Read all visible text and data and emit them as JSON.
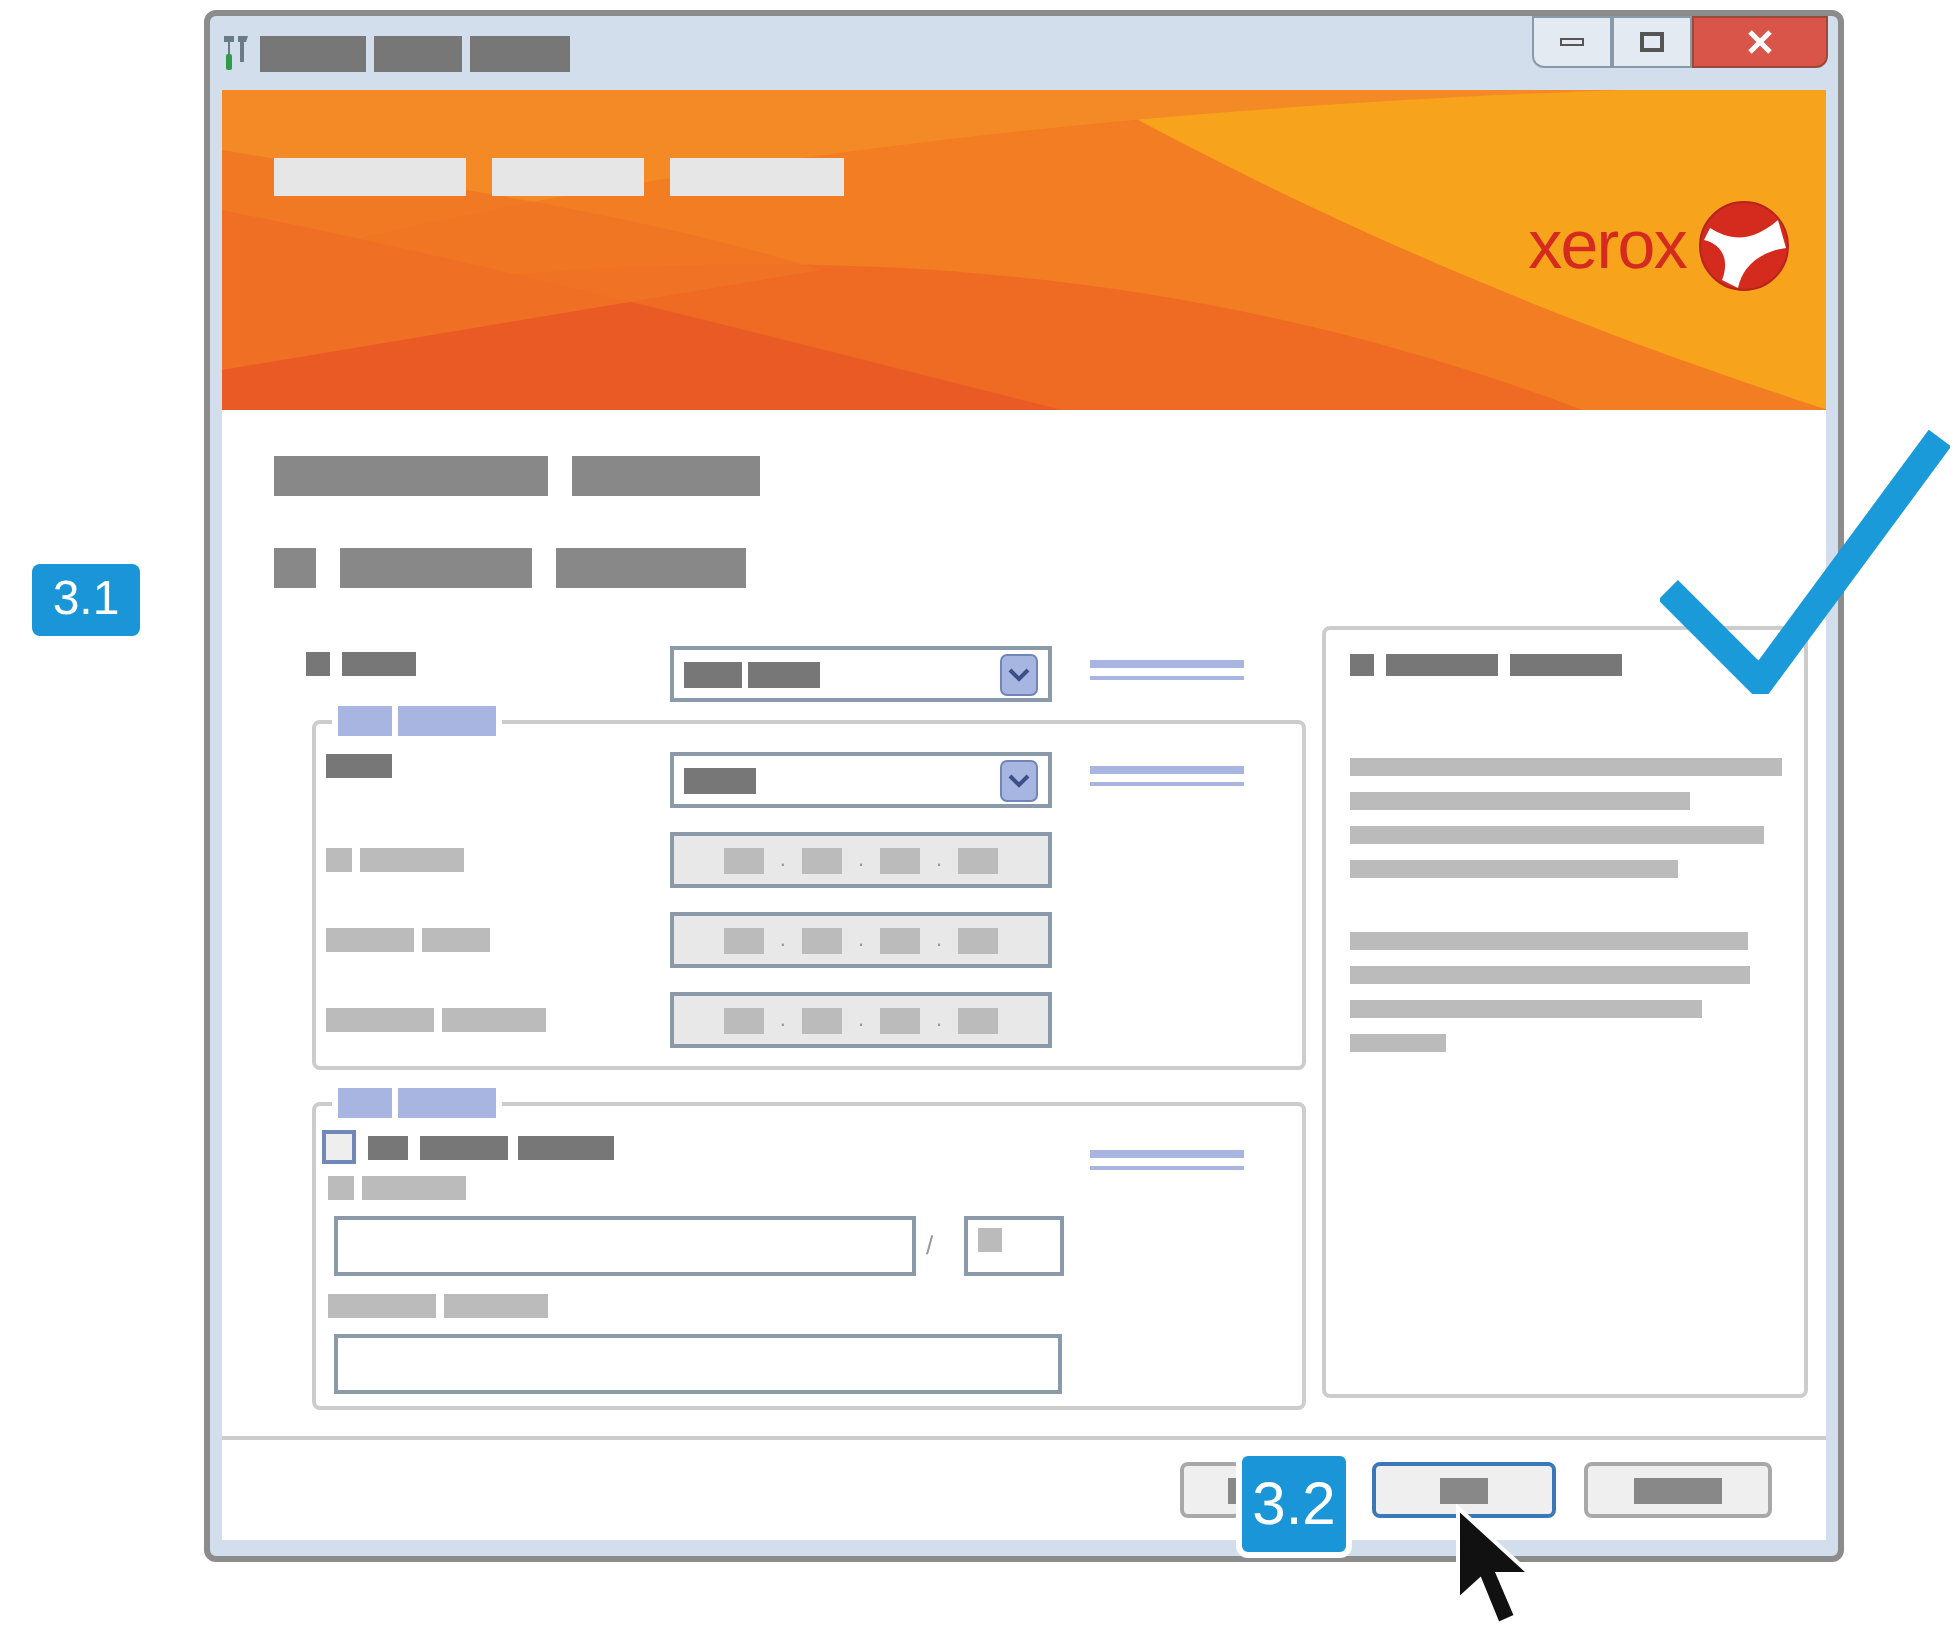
{
  "banner": {
    "logo": "xerox"
  },
  "callouts": [
    {
      "label": "3.1"
    },
    {
      "label": "3.2"
    }
  ],
  "ip_fields": [
    {
      "separators": [
        ".",
        ".",
        "."
      ]
    },
    {
      "separators": [
        ".",
        ".",
        "."
      ]
    },
    {
      "separators": [
        ".",
        ".",
        "."
      ]
    }
  ],
  "mask_separator": "/",
  "checkbox": {
    "checked": false
  },
  "buttons": [
    {
      "focused": false
    },
    {
      "focused": true
    },
    {
      "focused": false
    }
  ]
}
